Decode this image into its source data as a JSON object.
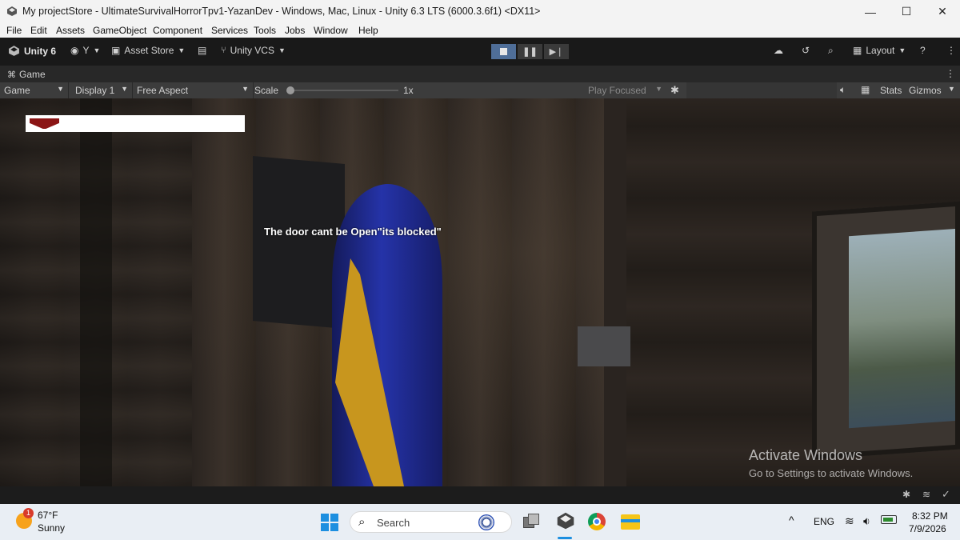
{
  "window": {
    "title": "My projectStore - UltimateSurvivalHorrorTpv1-YazanDev - Windows, Mac, Linux - Unity 6.3 LTS (6000.3.6f1) <DX11>",
    "minimize": "—",
    "maximize": "☐",
    "close": "✕"
  },
  "menu": [
    "File",
    "Edit",
    "Assets",
    "GameObject",
    "Component",
    "Services",
    "Tools",
    "Jobs",
    "Window",
    "Help"
  ],
  "toolbar": {
    "unity_label": "Unity 6",
    "account": "Y",
    "asset_store": "Asset Store",
    "vcs": "Unity VCS",
    "layout": "Layout"
  },
  "game_tab": {
    "label": "Game"
  },
  "game_bar": {
    "mode": "Game",
    "display": "Display 1",
    "aspect": "Free Aspect",
    "scale_label": "Scale",
    "scale_value": "1x",
    "play_focused": "Play Focused",
    "stats": "Stats",
    "gizmos": "Gizmos"
  },
  "scene": {
    "message": "The door cant be Open\"its blocked\"",
    "health_fill": 0.14,
    "watermark_title": "Activate Windows",
    "watermark_sub": "Go to Settings to activate Windows."
  },
  "taskbar": {
    "weather_temp": "67°F",
    "weather_text": "Sunny",
    "weather_badge": "1",
    "search_placeholder": "Search",
    "language": "ENG",
    "time": "8:32 PM",
    "date": "7/9/2026"
  },
  "colors": {
    "health_fill": "#8b1515",
    "play_active": "#4f6e98",
    "capsule": "#1f2a8c",
    "stripe": "#c8961e"
  }
}
